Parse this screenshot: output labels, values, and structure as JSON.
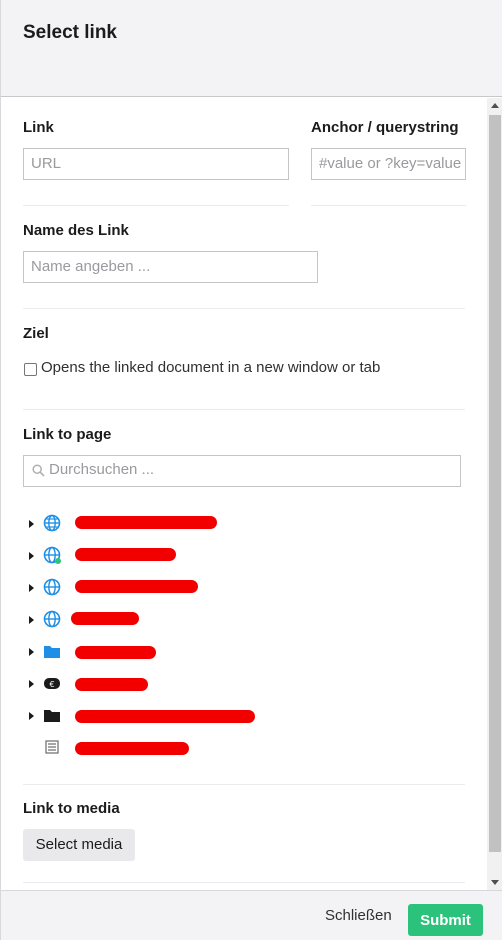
{
  "dialog": {
    "title": "Select link"
  },
  "link": {
    "label": "Link",
    "placeholder": "URL"
  },
  "anchor": {
    "label": "Anchor / querystring",
    "placeholder": "#value or ?key=value"
  },
  "name": {
    "label": "Name des Link",
    "placeholder": "Name angeben ..."
  },
  "target": {
    "label": "Ziel",
    "checkbox_label": "Opens the linked document in a new window or tab",
    "checked": false
  },
  "link_to_page": {
    "label": "Link to page",
    "search_placeholder": "Durchsuchen ...",
    "tree": [
      {
        "icon": "globe-icon",
        "label_redacted": true,
        "has_children": true
      },
      {
        "icon": "globe-icon",
        "label_redacted": true,
        "has_children": true
      },
      {
        "icon": "globe-icon",
        "label_redacted": true,
        "has_children": true
      },
      {
        "icon": "globe-icon",
        "label_redacted": true,
        "has_children": true
      },
      {
        "icon": "folder-icon",
        "label_redacted": true,
        "has_children": true
      },
      {
        "icon": "euro-icon",
        "label_redacted": true,
        "has_children": true
      },
      {
        "icon": "folder-icon",
        "label_redacted": true,
        "has_children": true
      },
      {
        "icon": "document-icon",
        "label_redacted": true,
        "has_children": false
      }
    ]
  },
  "link_to_media": {
    "label": "Link to media",
    "button_label": "Select media"
  },
  "footer": {
    "close_label": "Schließen",
    "submit_label": "Submit"
  },
  "colors": {
    "accent_submit": "#2bc37c",
    "globe_blue": "#1e8fe4",
    "folder_blue": "#1e8fe4",
    "redaction": "#f20000"
  }
}
